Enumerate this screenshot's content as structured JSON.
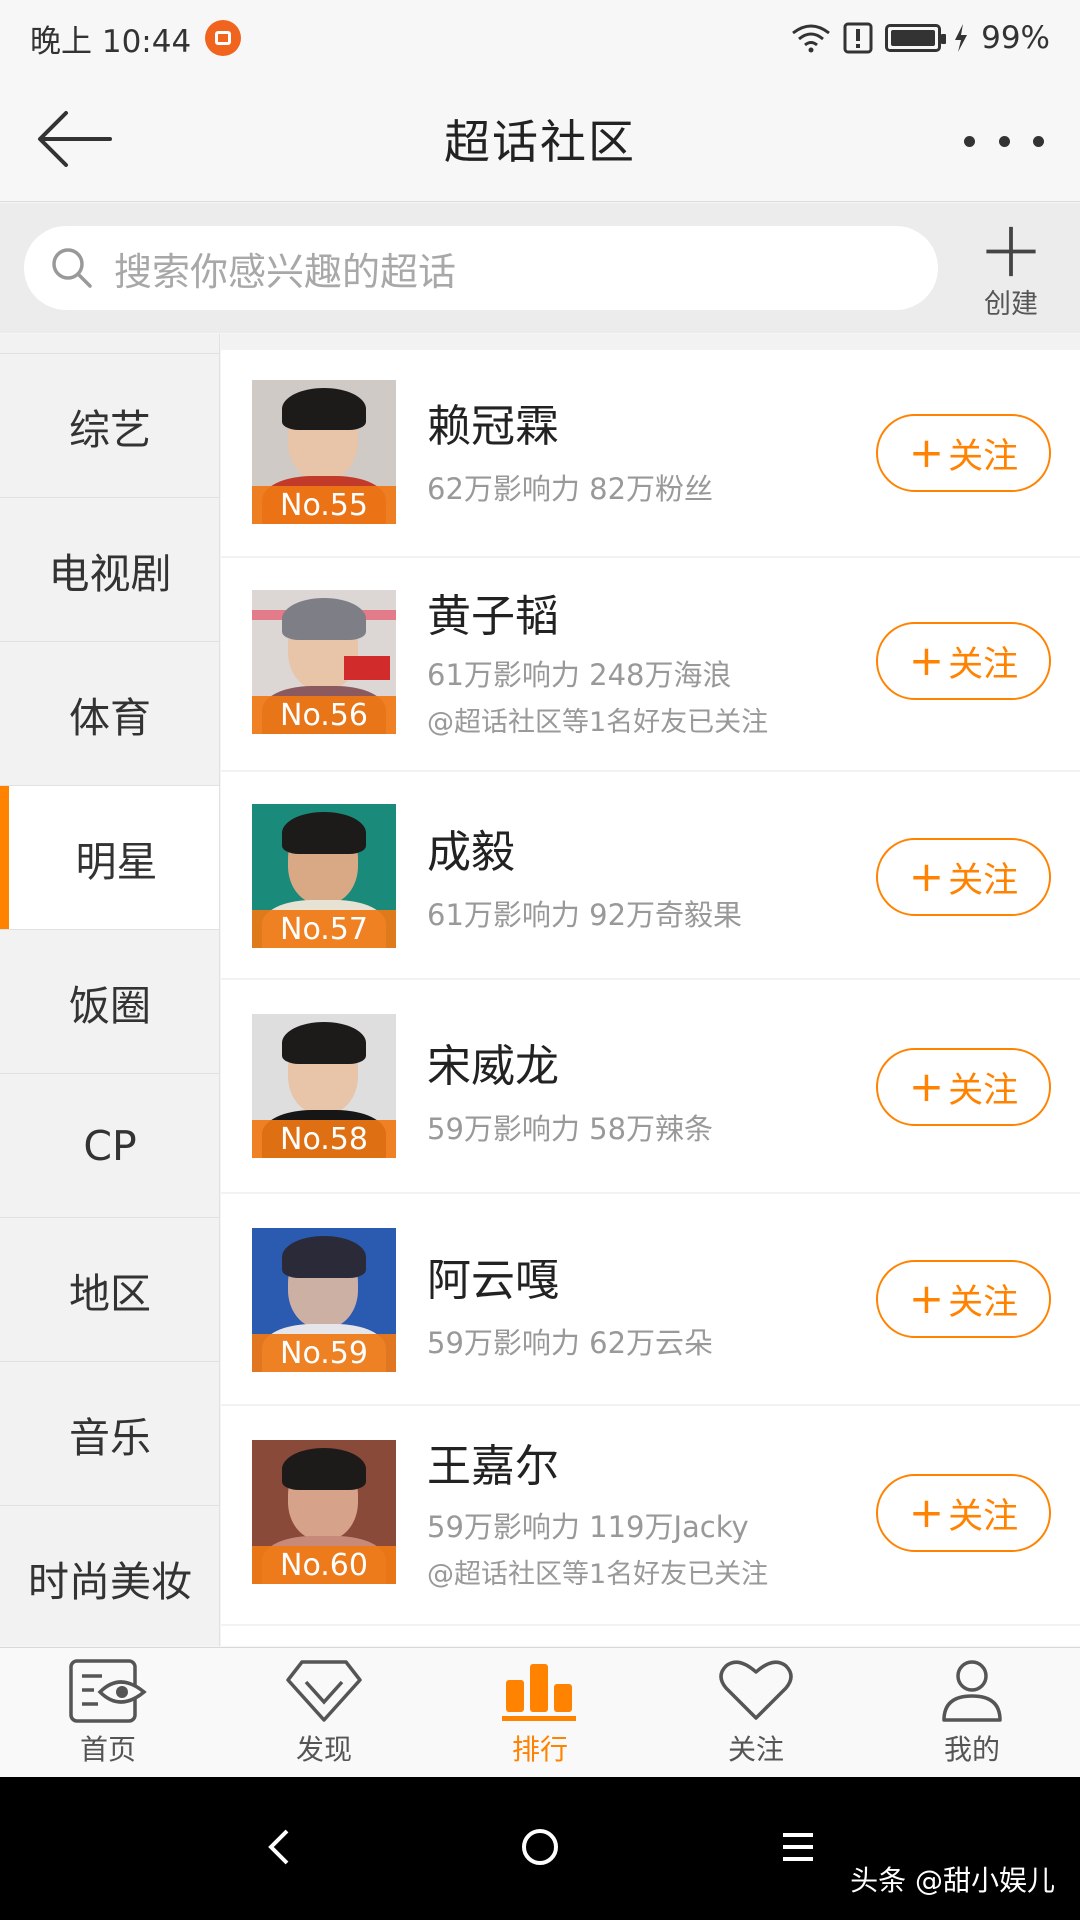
{
  "status_bar": {
    "time": "晚上 10:44",
    "battery_percent": "99%"
  },
  "header": {
    "title": "超话社区"
  },
  "search": {
    "placeholder": "搜索你感兴趣的超话",
    "create_label": "创建"
  },
  "sidebar": {
    "items": [
      {
        "label": "综艺"
      },
      {
        "label": "电视剧"
      },
      {
        "label": "体育"
      },
      {
        "label": "明星"
      },
      {
        "label": "饭圈"
      },
      {
        "label": "CP"
      },
      {
        "label": "地区"
      },
      {
        "label": "音乐"
      },
      {
        "label": "时尚美妆"
      }
    ],
    "active": "明星"
  },
  "list": {
    "follow_label": "关注",
    "rows": [
      {
        "rank": "No.55",
        "name": "赖冠霖",
        "stats": "62万影响力 82万粉丝",
        "friends": ""
      },
      {
        "rank": "No.56",
        "name": "黄子韬",
        "stats": "61万影响力 248万海浪",
        "friends": "@超话社区等1名好友已关注"
      },
      {
        "rank": "No.57",
        "name": "成毅",
        "stats": "61万影响力 92万奇毅果",
        "friends": ""
      },
      {
        "rank": "No.58",
        "name": "宋威龙",
        "stats": "59万影响力 58万辣条",
        "friends": ""
      },
      {
        "rank": "No.59",
        "name": "阿云嘎",
        "stats": "59万影响力 62万云朵",
        "friends": ""
      },
      {
        "rank": "No.60",
        "name": "王嘉尔",
        "stats": "59万影响力 119万Jacky",
        "friends": "@超话社区等1名好友已关注"
      }
    ]
  },
  "tabbar": {
    "tabs": [
      {
        "label": "首页",
        "icon": "eye-icon"
      },
      {
        "label": "发现",
        "icon": "diamond-icon"
      },
      {
        "label": "排行",
        "icon": "bar-chart-icon"
      },
      {
        "label": "关注",
        "icon": "heart-icon"
      },
      {
        "label": "我的",
        "icon": "person-icon"
      }
    ],
    "active": "排行"
  },
  "system_nav": {
    "watermark": "头条 @甜小娱儿"
  },
  "colors": {
    "accent": "#ff8200",
    "badge": "#f0781e"
  }
}
